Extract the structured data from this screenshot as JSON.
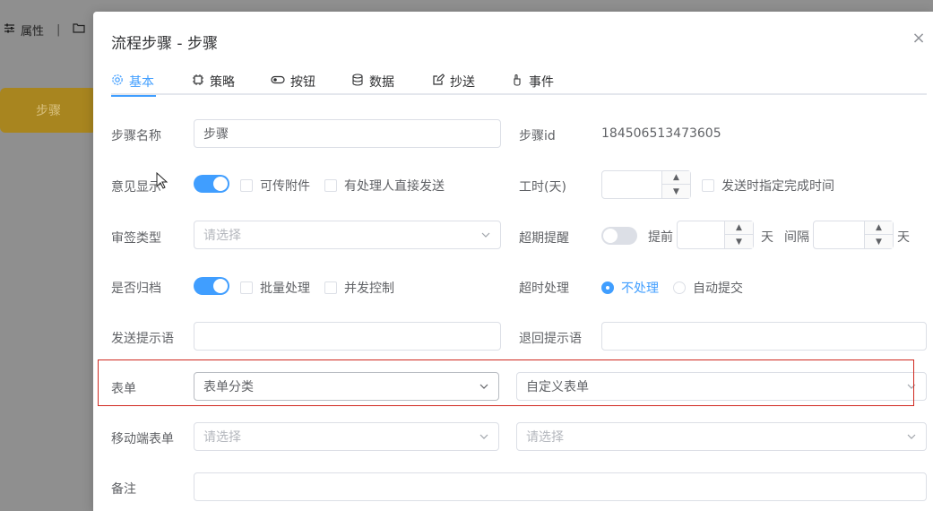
{
  "background": {
    "toolbar_attr_label": "属性",
    "node_label": "步骤"
  },
  "dialog": {
    "title": "流程步骤 - 步骤",
    "close_glyph": "×"
  },
  "tabs": [
    {
      "label": "基本",
      "icon": "gear-icon",
      "active": true
    },
    {
      "label": "策略",
      "icon": "chip-icon"
    },
    {
      "label": "按钮",
      "icon": "toggle-icon"
    },
    {
      "label": "数据",
      "icon": "database-icon"
    },
    {
      "label": "抄送",
      "icon": "edit-icon"
    },
    {
      "label": "事件",
      "icon": "hand-icon"
    }
  ],
  "form": {
    "step_name": {
      "label": "步骤名称",
      "value": "步骤"
    },
    "step_id": {
      "label": "步骤id",
      "value": "184506513473605"
    },
    "opinion_show": {
      "label": "意见显示",
      "switch_on": true
    },
    "attach_upload": {
      "label": "可传附件",
      "checked": false
    },
    "handler_direct_send": {
      "label": "有处理人直接发送",
      "checked": false
    },
    "workhours": {
      "label": "工时(天)",
      "value": ""
    },
    "specify_finish_time": {
      "label": "发送时指定完成时间",
      "checked": false
    },
    "sign_type": {
      "label": "审签类型",
      "placeholder": "请选择"
    },
    "overdue_remind": {
      "label": "超期提醒",
      "switch_on": false,
      "before_label": "提前",
      "before_unit": "天",
      "interval_label": "间隔",
      "interval_unit": "天"
    },
    "archive": {
      "label": "是否归档",
      "switch_on": true
    },
    "batch_process": {
      "label": "批量处理",
      "checked": false
    },
    "concurrency_control": {
      "label": "并发控制",
      "checked": false
    },
    "timeout_process": {
      "label": "超时处理",
      "options": [
        "不处理",
        "自动提交"
      ],
      "selected": "不处理"
    },
    "send_prompt": {
      "label": "发送提示语",
      "value": ""
    },
    "return_prompt": {
      "label": "退回提示语",
      "value": ""
    },
    "form_select": {
      "label": "表单",
      "category_value": "表单分类",
      "form_value": "自定义表单"
    },
    "mobile_form": {
      "label": "移动端表单",
      "category_placeholder": "请选择",
      "form_placeholder": "请选择"
    },
    "remark": {
      "label": "备注",
      "value": ""
    }
  },
  "colors": {
    "accent": "#409eff",
    "highlight_border": "#d0281f"
  }
}
